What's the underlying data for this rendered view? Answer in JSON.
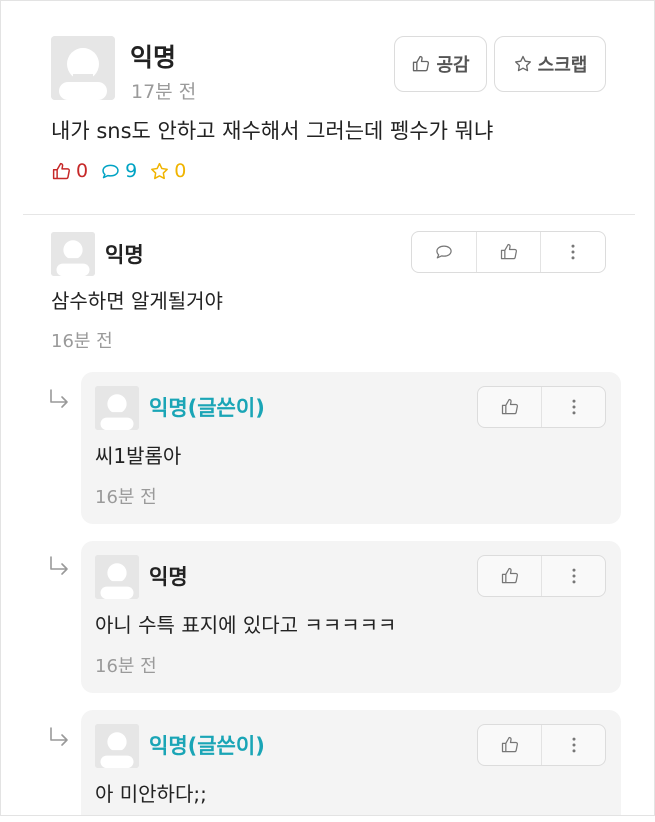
{
  "post": {
    "author": "익명",
    "time": "17분 전",
    "like_button": "공감",
    "scrap_button": "스크랩",
    "title": "내가 sns도 안하고 재수해서 그러는데 펭수가 뭐냐",
    "stats": {
      "likes": "0",
      "comments": "9",
      "scraps": "0"
    }
  },
  "comments": [
    {
      "author": "익명",
      "text": "삼수하면 알게될거야",
      "time": "16분 전",
      "replies": [
        {
          "author": "익명(글쓴이)",
          "text": "씨1발롬아",
          "time": "16분 전"
        },
        {
          "author": "익명",
          "text": "아니 수특 표지에 있다고 ㅋㅋㅋㅋㅋ",
          "time": "16분 전"
        },
        {
          "author": "익명(글쓴이)",
          "text": "아 미안하다;;",
          "time": ""
        }
      ]
    }
  ],
  "colors": {
    "like_stat": "#c62828",
    "comment_stat": "#00a3c4",
    "scrap_stat": "#f0b400",
    "op_author": "#1aa5b6"
  },
  "icons": {
    "like": "thumbs-up-icon",
    "scrap": "star-icon",
    "comment": "speech-bubble-icon",
    "more": "vertical-dots-icon",
    "reply": "reply-arrow-icon"
  }
}
